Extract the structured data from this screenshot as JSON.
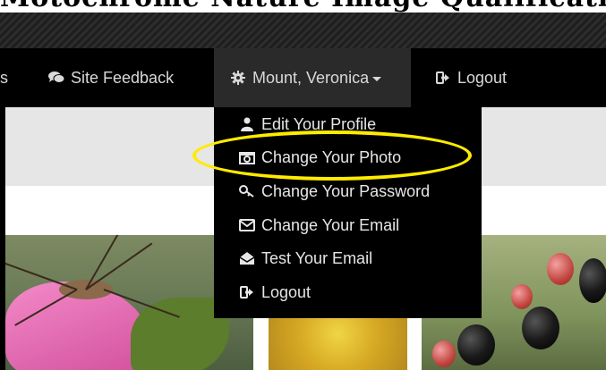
{
  "banner": {
    "cut_text": "Motochrome Nature Image Qualification"
  },
  "nav": {
    "partial_left": "s",
    "site_feedback": "Site Feedback",
    "user_menu": "Mount, Veronica",
    "logout": "Logout"
  },
  "dropdown": {
    "items": [
      {
        "label": "Edit Your Profile",
        "icon": "user-icon"
      },
      {
        "label": "Change Your Photo",
        "icon": "camera-icon"
      },
      {
        "label": "Change Your Password",
        "icon": "key-icon"
      },
      {
        "label": "Change Your Email",
        "icon": "envelope-icon"
      },
      {
        "label": "Test Your Email",
        "icon": "envelope-open-icon"
      },
      {
        "label": "Logout",
        "icon": "sign-out-icon"
      }
    ]
  },
  "colors": {
    "highlight": "#ffeb00",
    "nav_bg": "#000000",
    "nav_text": "#d9d9d9"
  }
}
